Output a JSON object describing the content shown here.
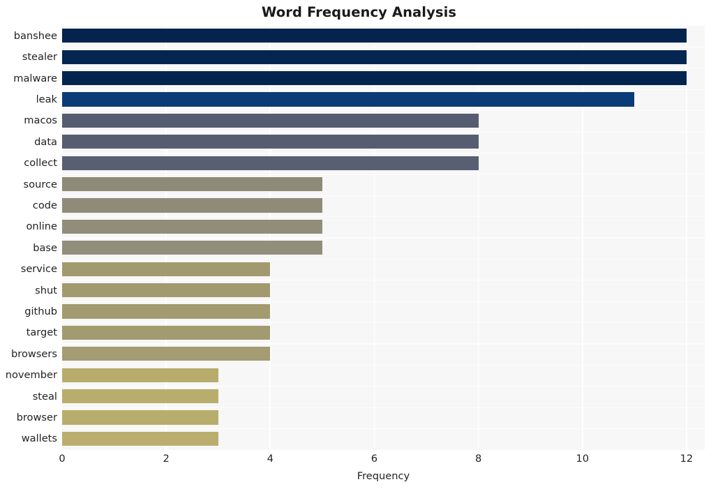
{
  "chart_data": {
    "type": "bar",
    "orientation": "horizontal",
    "title": "Word Frequency Analysis",
    "xlabel": "Frequency",
    "ylabel": "",
    "xlim": [
      0,
      12.35
    ],
    "xticks": [
      0,
      2,
      4,
      6,
      8,
      10,
      12
    ],
    "xtick_labels": [
      "0",
      "2",
      "4",
      "6",
      "8",
      "10",
      "12"
    ],
    "grid": true,
    "grid_color": "#ffffff",
    "plot_background": "#f7f7f7",
    "figure_background": "#ffffff",
    "legend": null,
    "categories": [
      "banshee",
      "stealer",
      "malware",
      "leak",
      "macos",
      "data",
      "collect",
      "source",
      "code",
      "online",
      "base",
      "service",
      "shut",
      "github",
      "target",
      "browsers",
      "november",
      "steal",
      "browser",
      "wallets"
    ],
    "values": [
      12,
      12,
      12,
      11,
      8,
      8,
      8,
      5,
      5,
      5,
      5,
      4,
      4,
      4,
      4,
      4,
      3,
      3,
      3,
      3
    ],
    "bar_colors": [
      "#04244d",
      "#032550",
      "#042450",
      "#0b3b77",
      "#565d70",
      "#565d71",
      "#585f72",
      "#8e8a78",
      "#8f8b78",
      "#918d7b",
      "#928e7c",
      "#a29a6f",
      "#a29a6f",
      "#a39b70",
      "#a39b70",
      "#a49c72",
      "#b8ac6d",
      "#b9ad6e",
      "#b9ad6e",
      "#baae6f"
    ]
  }
}
